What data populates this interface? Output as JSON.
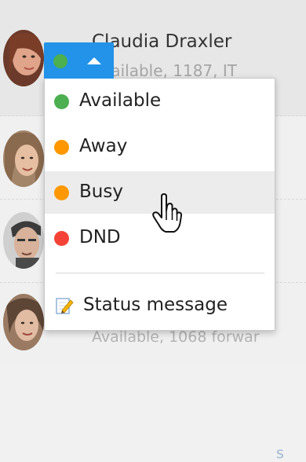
{
  "contact_top": {
    "name": "Claudia Draxler",
    "status_line": "Available, 1187, IT"
  },
  "contact_bottom": {
    "status_line": "Available, 1068 forwar"
  },
  "side_link_text": "s",
  "status_toggle": {
    "current_status_color": "#4caf50",
    "background_color": "#2293e8"
  },
  "menu": {
    "items": [
      {
        "label": "Available",
        "color": "#4caf50"
      },
      {
        "label": "Away",
        "color": "#ff9800"
      },
      {
        "label": "Busy",
        "color": "#ff9800"
      },
      {
        "label": "DND",
        "color": "#f44336"
      }
    ],
    "status_message_label": "Status message"
  }
}
